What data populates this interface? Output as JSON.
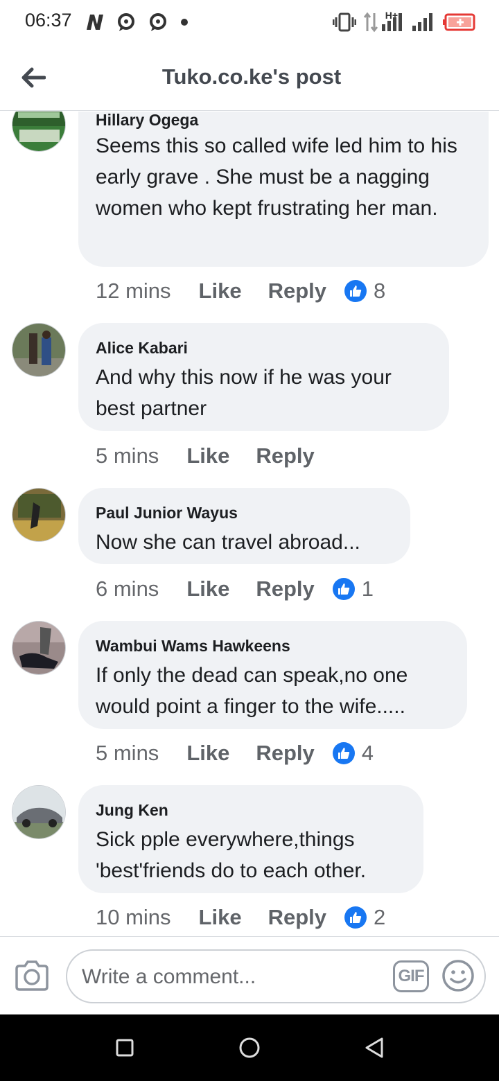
{
  "status_bar": {
    "time": "06:37",
    "network_label": "H+",
    "icons": [
      "n-app-icon",
      "chat-icon",
      "chat-icon",
      "dot-icon",
      "vibrate-icon",
      "data-arrows-icon",
      "signal-icon",
      "signal-icon",
      "battery-low-icon"
    ]
  },
  "header": {
    "title": "Tuko.co.ke's post",
    "back_icon": "arrow-left-icon"
  },
  "comments": [
    {
      "author": "Hillary Ogega",
      "text": "Seems this so called wife led him to his early grave . She must be a nagging women who kept frustrating her man.",
      "time": "12 mins",
      "like": "Like",
      "reply": "Reply",
      "reactions": "8"
    },
    {
      "author": "Alice Kabari",
      "text": "And why this now if he was your best partner",
      "time": "5 mins",
      "like": "Like",
      "reply": "Reply",
      "reactions": ""
    },
    {
      "author": "Paul Junior Wayus",
      "text": "Now she can travel abroad...",
      "time": "6 mins",
      "like": "Like",
      "reply": "Reply",
      "reactions": "1"
    },
    {
      "author": "Wambui Wams Hawkeens",
      "text": "If only the dead can speak,no one would point a finger to the wife.....",
      "time": "5 mins",
      "like": "Like",
      "reply": "Reply",
      "reactions": "4"
    },
    {
      "author": "Jung Ken",
      "text": "Sick pple everywhere,things 'best'friends do to each other.",
      "time": "10 mins",
      "like": "Like",
      "reply": "Reply",
      "reactions": "2"
    }
  ],
  "composer": {
    "placeholder": "Write a comment...",
    "gif_label": "GIF",
    "camera_icon": "camera-icon",
    "emoji_icon": "smiley-icon"
  },
  "system_nav": {
    "icons": [
      "recents-square-icon",
      "home-circle-icon",
      "back-triangle-icon"
    ]
  },
  "colors": {
    "bubble": "#f0f2f5",
    "like_blue": "#1877f2",
    "meta_gray": "#65676b",
    "nav_bar": "#000000"
  }
}
